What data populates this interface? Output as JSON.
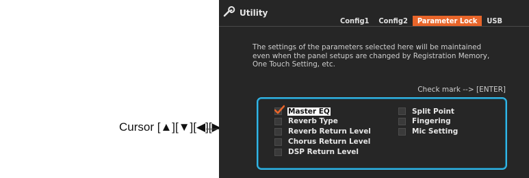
{
  "annotation": {
    "text": "Cursor [▲][▼][◀][▶], [ENTER]"
  },
  "screen": {
    "title": "Utility",
    "app_icon": "wrench-icon",
    "tabs": [
      {
        "label": "Config1",
        "active": false
      },
      {
        "label": "Config2",
        "active": false
      },
      {
        "label": "Parameter Lock",
        "active": true
      },
      {
        "label": "USB",
        "active": false
      }
    ],
    "description": "The settings of the parameters selected here will be maintained\neven when the panel setups are changed by Registration Memory,\nOne Touch Setting, etc.",
    "checkmark_hint": "Check mark --> [ENTER]",
    "parameters_col1": [
      {
        "label": "Master EQ",
        "checked": true,
        "cursor": true
      },
      {
        "label": "Reverb Type",
        "checked": false,
        "cursor": false
      },
      {
        "label": "Reverb Return Level",
        "checked": false,
        "cursor": false
      },
      {
        "label": "Chorus Return Level",
        "checked": false,
        "cursor": false
      },
      {
        "label": "DSP Return Level",
        "checked": false,
        "cursor": false
      }
    ],
    "parameters_col2": [
      {
        "label": "Split Point",
        "checked": false,
        "cursor": false
      },
      {
        "label": "Fingering",
        "checked": false,
        "cursor": false
      },
      {
        "label": "Mic Setting",
        "checked": false,
        "cursor": false
      }
    ],
    "colors": {
      "active_tab": "#e8652a",
      "checkmark": "#e8652a",
      "highlight_frame": "#33b6e6",
      "background": "#262626"
    }
  }
}
